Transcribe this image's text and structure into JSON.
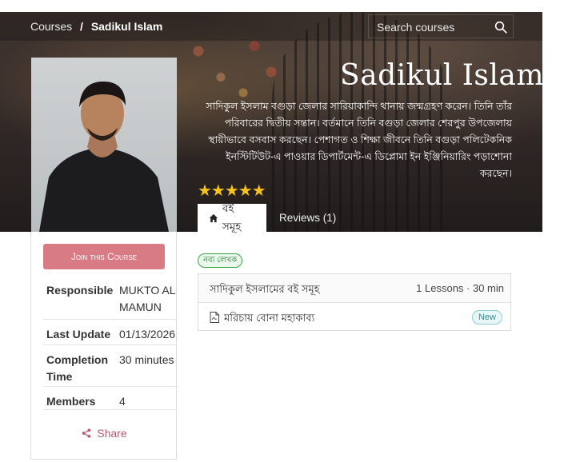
{
  "breadcrumb": {
    "parent": "Courses",
    "separator": "/",
    "current": "Sadikul Islam"
  },
  "search": {
    "placeholder": "Search courses",
    "icon": "search-icon"
  },
  "course": {
    "title": "Sadikul Islam",
    "description": "সাদিকুল ইসলাম বগুড়া জেলার সারিয়াকান্দি থানায় জন্মগ্রহণ করেন। তিনি তাঁর পরিবারের দ্বিতীয় সন্তান। বর্তমানে তিনি বগুড়া জেলার শেরপুর উপজেলায় স্থায়ীভাবে বসবাস করছেন। পেশাগত ও শিক্ষা জীবনে তিনি বগুড়া পলিটেকনিক ইনস্টিটিউট-এ পাওয়ার ডিপার্টমেন্ট-এ ডিপ্লোমা ইন ইঞ্জিনিয়ারিং পড়াশোনা করছেন।",
    "rating": 5,
    "stars": "★★★★★",
    "star_color": "#f7c21b"
  },
  "tabs": [
    {
      "label": "বই সমূহ",
      "icon": "home-icon",
      "active": true
    },
    {
      "label": "Reviews (1)",
      "active": false
    }
  ],
  "sidebar": {
    "join_label": "Join this Course",
    "join_color": "#d97b84",
    "info": [
      {
        "label": "Responsible",
        "value": "MUKTO AL MAMUN"
      },
      {
        "label": "Last Update",
        "value": "01/13/2026"
      },
      {
        "label": "Completion Time",
        "value": "30 minutes"
      },
      {
        "label": "Members",
        "value": "4"
      }
    ],
    "share_label": "Share",
    "share_icon": "share-icon"
  },
  "content": {
    "tag": "নব্য লেখক",
    "section": {
      "title": "সাদিকুল ইসলামের বই সমূহ",
      "meta": "1 Lessons · 30 min",
      "lessons": [
        {
          "title": "মরিচায় বোনা মহাকাব্য",
          "icon": "document-icon",
          "badge": "New"
        }
      ]
    }
  }
}
